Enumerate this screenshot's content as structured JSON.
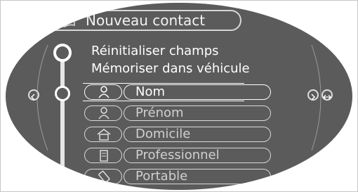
{
  "header": {
    "title": "Nouveau contact",
    "icon": "book-icon"
  },
  "menu": {
    "items": [
      {
        "label": "Réinitialiser champs"
      },
      {
        "label": "Mémoriser dans véhicule"
      }
    ]
  },
  "fields": [
    {
      "label": "Nom",
      "icon": "person-icon",
      "selected": true
    },
    {
      "label": "Prénom",
      "icon": "person-icon",
      "selected": false
    },
    {
      "label": "Domicile",
      "icon": "home-icon",
      "selected": false
    },
    {
      "label": "Professionnel",
      "icon": "office-icon",
      "selected": false
    },
    {
      "label": "Portable",
      "icon": "mobile-phone-icon",
      "selected": false
    }
  ],
  "nav": {
    "left_icon": "chevron-left-icon",
    "right_icon": "chevron-right-icon",
    "right2_icon": "double-arrow-icon"
  },
  "colors": {
    "background": "#5b5b5b",
    "foreground": "#ffffff"
  }
}
